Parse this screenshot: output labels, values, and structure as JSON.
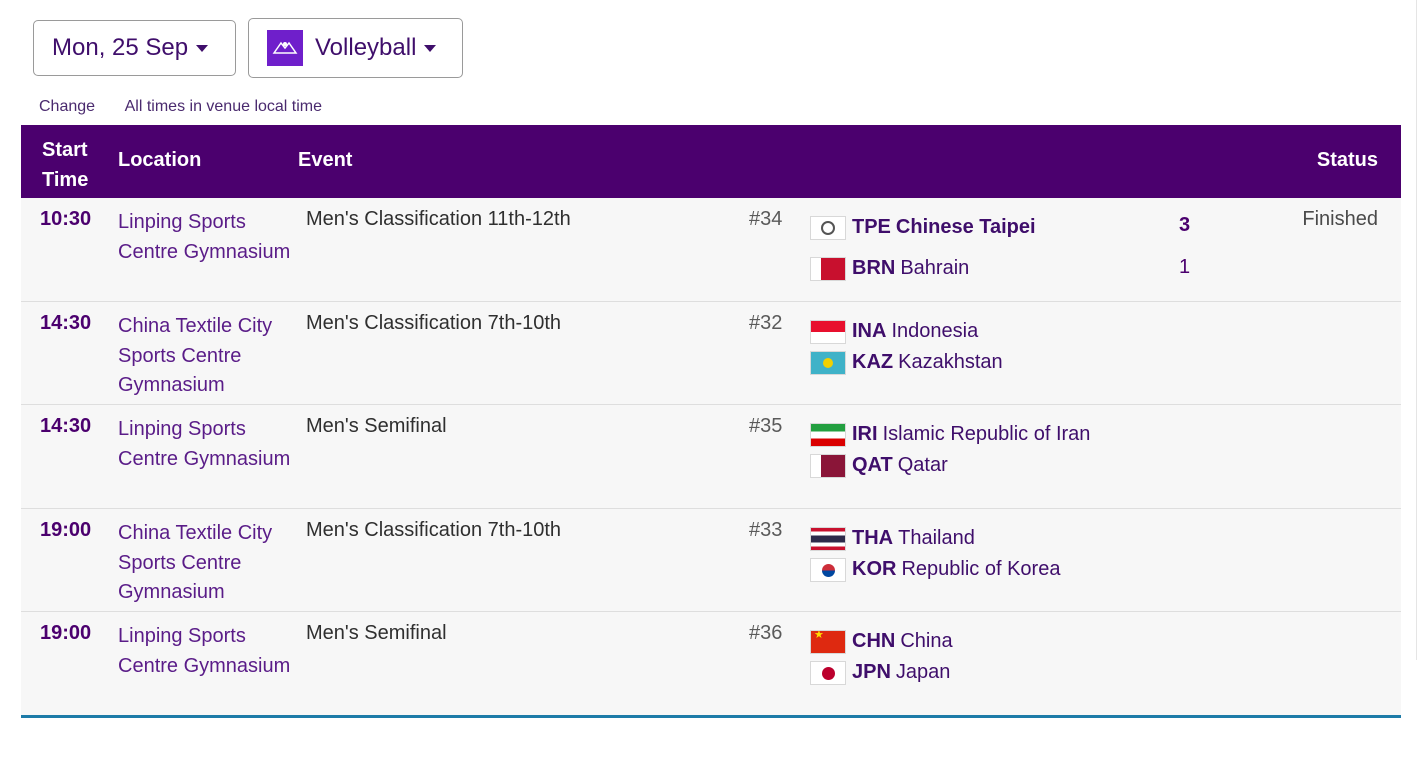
{
  "controls": {
    "date_label": "Mon, 25 Sep",
    "sport_label": "Volleyball",
    "sport_icon": "volleyball-icon",
    "change_link": "Change",
    "timezone_note": "All times in venue local time"
  },
  "colors": {
    "header_bg": "#4b006e",
    "accent": "#3f0e6b",
    "bottom_rule": "#1d7ba8"
  },
  "table": {
    "headers": {
      "start_time": "Start Time",
      "location": "Location",
      "event": "Event",
      "status": "Status"
    },
    "rows": [
      {
        "time": "10:30",
        "location": "Linping Sports Centre Gymnasium",
        "event": "Men's Classification 11th-12th",
        "match_no": "#34",
        "team1": {
          "code": "TPE",
          "name": "Chinese Taipei",
          "flag": "tpe-flag",
          "score": "3"
        },
        "team2": {
          "code": "BRN",
          "name": "Bahrain",
          "flag": "brn-flag",
          "score": "1"
        },
        "status": "Finished"
      },
      {
        "time": "14:30",
        "location": "China Textile City Sports Centre Gymnasium",
        "event": "Men's Classification 7th-10th",
        "match_no": "#32",
        "team1": {
          "code": "INA",
          "name": "Indonesia",
          "flag": "ina-flag"
        },
        "team2": {
          "code": "KAZ",
          "name": "Kazakhstan",
          "flag": "kaz-flag"
        }
      },
      {
        "time": "14:30",
        "location": "Linping Sports Centre Gymnasium",
        "event": "Men's Semifinal",
        "match_no": "#35",
        "team1": {
          "code": "IRI",
          "name": "Islamic Republic of Iran",
          "flag": "iri-flag"
        },
        "team2": {
          "code": "QAT",
          "name": "Qatar",
          "flag": "qat-flag"
        }
      },
      {
        "time": "19:00",
        "location": "China Textile City Sports Centre Gymnasium",
        "event": "Men's Classification 7th-10th",
        "match_no": "#33",
        "team1": {
          "code": "THA",
          "name": "Thailand",
          "flag": "tha-flag"
        },
        "team2": {
          "code": "KOR",
          "name": "Republic of Korea",
          "flag": "kor-flag"
        }
      },
      {
        "time": "19:00",
        "location": "Linping Sports Centre Gymnasium",
        "event": "Men's Semifinal",
        "match_no": "#36",
        "team1": {
          "code": "CHN",
          "name": "China",
          "flag": "chn-flag"
        },
        "team2": {
          "code": "JPN",
          "name": "Japan",
          "flag": "jpn-flag"
        }
      }
    ]
  }
}
